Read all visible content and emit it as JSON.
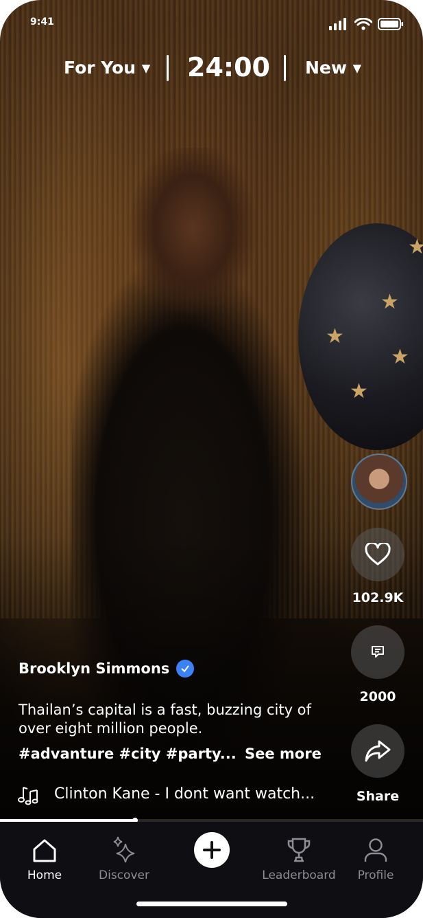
{
  "status_bar": {
    "time": "9:41"
  },
  "feed_header": {
    "tab_left": "For You ▾",
    "timer": "24:00",
    "tab_right": "New ▾"
  },
  "actions": {
    "likes": "102.9K",
    "comments": "2000",
    "share": "Share"
  },
  "post": {
    "author": "Brooklyn Simmons",
    "caption": "Thailan’s capital is a fast, buzzing city of over eight million people.",
    "hashtags": "#advanture #city #party...",
    "see_more": "See more",
    "music": "Clinton Kane - I dont want watch..."
  },
  "playback": {
    "progress_fraction": 0.32
  },
  "bottom_nav": {
    "items": [
      {
        "label": "Home",
        "icon": "home-icon",
        "active": true
      },
      {
        "label": "Discover",
        "icon": "sparkles-icon",
        "active": false
      },
      {
        "label": "",
        "icon": "plus-icon",
        "active": false
      },
      {
        "label": "Leaderboard",
        "icon": "trophy-icon",
        "active": false
      },
      {
        "label": "Profile",
        "icon": "user-icon",
        "active": false
      }
    ]
  },
  "colors": {
    "verified": "#3b82f6",
    "nav_bg": "#0f0e12",
    "inactive_nav": "#8d8d93"
  }
}
